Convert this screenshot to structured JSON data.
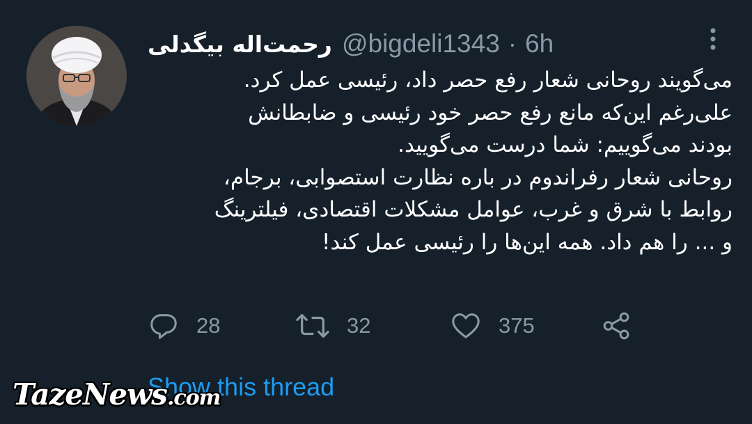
{
  "colors": {
    "background": "#15202b",
    "primary_text": "#ffffff",
    "secondary_text": "#8b98a5",
    "link": "#1d9bf0"
  },
  "tweet": {
    "author": {
      "display_name": "رحمت‌اله بیگدلی",
      "handle": "@bigdeli1343",
      "avatar_icon": "avatar-photo"
    },
    "separator": "·",
    "time": "6h",
    "more_icon": "more-vertical-icon",
    "text_lines": [
      "می‌گویند روحانی شعار رفع حصر داد، رئیسی عمل کرد.",
      "علی‌رغم این‌که مانع رفع حصر خود رئیسی و ضابطانش",
      "بودند می‌گوییم: شما درست می‌گویید.",
      "روحانی شعار رفراندوم در باره نظارت استصوابی، برجام،",
      "روابط با شرق و غرب، عوامل مشکلات اقتصادی، فیلترینگ",
      "و ... را هم داد. همه این‌ها را رئیسی عمل کند!"
    ],
    "actions": {
      "reply": {
        "icon": "reply-icon",
        "count": "28"
      },
      "retweet": {
        "icon": "retweet-icon",
        "count": "32"
      },
      "like": {
        "icon": "heart-icon",
        "count": "375"
      },
      "share": {
        "icon": "share-icon"
      }
    },
    "show_thread": "Show this thread"
  },
  "watermark": {
    "text_main": "TazeNews",
    "text_suffix": ".com"
  }
}
